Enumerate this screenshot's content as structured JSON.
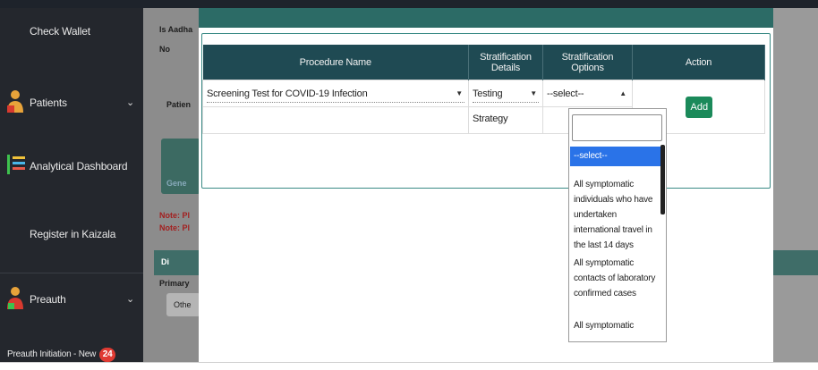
{
  "sidebar": {
    "items": [
      {
        "label": "Check Wallet"
      },
      {
        "label": "Patients",
        "chevron": "⌄"
      },
      {
        "label": "Analytical Dashboard"
      },
      {
        "label": "Register in Kaizala"
      },
      {
        "label": "Preauth",
        "chevron": "⌄"
      },
      {
        "label": "Preauth Initiation - New",
        "badge": "24"
      }
    ]
  },
  "background": {
    "fragments": [
      "Is Aadha",
      "No",
      "Patien",
      "Gene",
      "Note: Pl",
      "Note: Pl",
      "Di",
      "Primary",
      "Othe"
    ]
  },
  "table": {
    "headers": [
      "Procedure Name",
      "Stratification Details",
      "Stratification Options",
      "Action"
    ],
    "row": {
      "procedure": "Screening Test for COVID-19 Infection",
      "details": "Testing Strategy",
      "options": "--select--",
      "action": "Add"
    }
  },
  "dropdown": {
    "options": [
      "--select--",
      "All symptomatic individuals who have undertaken international travel in the last 14 days",
      "All symptomatic contacts of laboratory confirmed cases",
      "All symptomatic"
    ]
  },
  "colors": {
    "sidebar": "#24272d",
    "header": "#1f4a53",
    "add_button": "#1b8a5a",
    "highlight": "#2a73e8"
  }
}
